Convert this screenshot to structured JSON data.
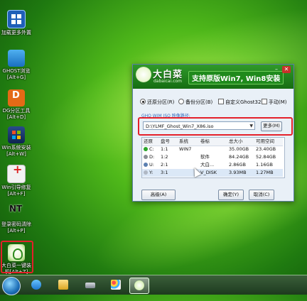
{
  "desktop": {
    "icons": [
      {
        "label": "加载更多外置",
        "icon": "grid-icon"
      },
      {
        "label": "GHOST浏览\n[Alt+G]",
        "icon": "ghost-icon"
      },
      {
        "label": "DG分区工具\n[Alt+D]",
        "icon": "diskgenius-icon"
      },
      {
        "label": "Win系统安装\n[Alt+W]",
        "icon": "windows-icon"
      },
      {
        "label": "Win引导修复\n[Alt+F]",
        "icon": "repair-icon"
      },
      {
        "label": "登录密码清除\n[Alt+P]",
        "icon": "nt-password-icon"
      },
      {
        "label": "大白菜一键装\n机[Alt+Z]",
        "icon": "dabaicai-icon"
      }
    ]
  },
  "dialog": {
    "brand": "大白菜",
    "brand_sub": "dabaicai.com",
    "slogan": "支持原版Win7, Win8安装",
    "options": {
      "restore": "还原分区(R)",
      "backup": "备份分区(B)",
      "custom_ghost": "自定义Ghost32",
      "manual": "手动(M)"
    },
    "path_label": "GHO WIM ISO 映像路径:",
    "path_value": "D:\\YLMF_Ghost_Win7_X86.iso",
    "more_button": "更多(M)",
    "table": {
      "headers": [
        "还原",
        "盘号",
        "系统",
        "卷标",
        "总大小",
        "可用空间"
      ],
      "rows": [
        {
          "icon": "check-icon",
          "drive": "C:",
          "disk": "1:1",
          "system": "WIN7",
          "label": "",
          "size": "35.00GB",
          "free": "23.40GB"
        },
        {
          "icon": "drive-icon",
          "drive": "D:",
          "disk": "1:2",
          "system": "",
          "label": "软件",
          "size": "84.24GB",
          "free": "52.84GB"
        },
        {
          "icon": "usb-icon",
          "drive": "U:",
          "disk": "2:1",
          "system": "",
          "label": "大白...",
          "size": "2.86GB",
          "free": "1.16GB"
        },
        {
          "icon": "cdrom-icon",
          "drive": "Y:",
          "disk": "3:1",
          "system": "",
          "label": "V_DISK",
          "size": "3.93MB",
          "free": "1.27MB"
        }
      ]
    },
    "buttons": {
      "advanced": "高级(A)",
      "ok": "确定(Y)",
      "cancel": "取消(C)"
    }
  },
  "taskbar": {
    "items": [
      "start-orb",
      "ie-icon",
      "explorer-icon",
      "drive-icon",
      "paint-icon",
      "dabaicai-icon"
    ]
  },
  "colors": {
    "highlight": "#e4202a",
    "dialog_header": "#1f8a1c"
  }
}
